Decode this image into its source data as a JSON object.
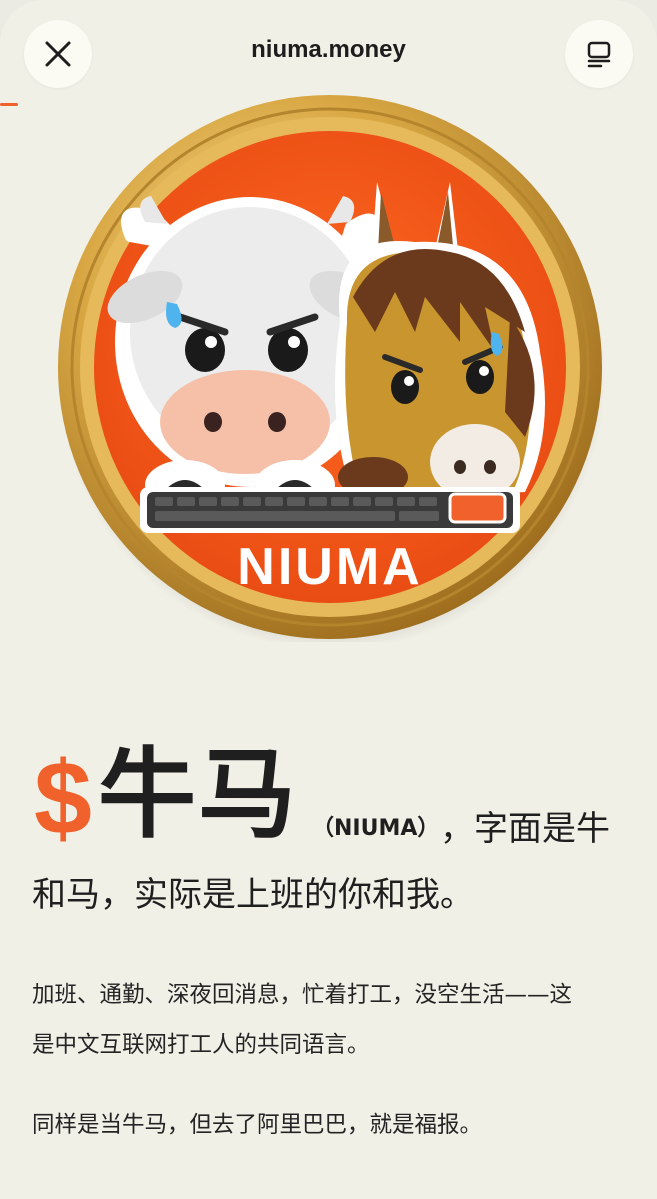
{
  "browser": {
    "site_title": "niuma.money",
    "close_icon": "close-icon",
    "tabs_icon": "tabs-icon"
  },
  "coin": {
    "label": "NIUMA",
    "colors": {
      "gold": "#d9a844",
      "orange": "#f0581c",
      "keyboard": "#3a3a3a",
      "orange_key": "#f0612b"
    }
  },
  "headline": {
    "dollar": "$",
    "name": "牛马",
    "paren": "（NIUMA）",
    "rest_line1": "，字面是牛",
    "rest_line2": "和马，实际是上班的你和我。"
  },
  "body": {
    "para1_line1": "加班、通勤、深夜回消息，忙着打工，没空生活——这",
    "para1_line2": "是中文互联网打工人的共同语言。",
    "para2": "同样是当牛马，但去了阿里巴巴，就是福报。"
  },
  "theme": {
    "accent": "#f0612b",
    "background": "#f1f0e7",
    "text": "#1f1f1f"
  }
}
